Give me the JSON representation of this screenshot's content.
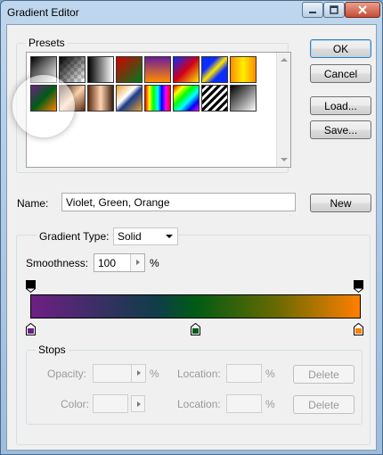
{
  "window": {
    "title": "Gradient Editor"
  },
  "presets": {
    "label": "Presets",
    "swatches": [
      "black-white",
      "transparent-checker",
      "black-white-2",
      "red-green",
      "violet-orange",
      "blue-red-yellow",
      "blue-yellow-blue",
      "orange-yellow-orange",
      "violet-green-orange",
      "copper-1",
      "copper-2",
      "chrome-diagonal",
      "spectrum",
      "rainbow-diagonal",
      "stripes",
      "black-white-diagonal"
    ]
  },
  "buttons": {
    "ok": "OK",
    "cancel": "Cancel",
    "load": "Load...",
    "save": "Save...",
    "new": "New"
  },
  "name": {
    "label": "Name:",
    "value": "Violet, Green, Orange"
  },
  "gradient": {
    "type_label": "Gradient Type:",
    "type_value": "Solid",
    "smoothness_label": "Smoothness:",
    "smoothness_value": "100",
    "smoothness_unit": "%",
    "colors": {
      "start": "#6e1f84",
      "mid": "#005b15",
      "end": "#ff7f00"
    }
  },
  "stops": {
    "label": "Stops",
    "opacity_label": "Opacity:",
    "opacity_unit": "%",
    "location_label": "Location:",
    "location_unit": "%",
    "color_label": "Color:",
    "delete_label": "Delete"
  },
  "icons": [
    "minimize-icon",
    "maximize-icon",
    "close-icon",
    "flyout-menu-icon",
    "scroll-up-icon",
    "scroll-down-icon"
  ]
}
